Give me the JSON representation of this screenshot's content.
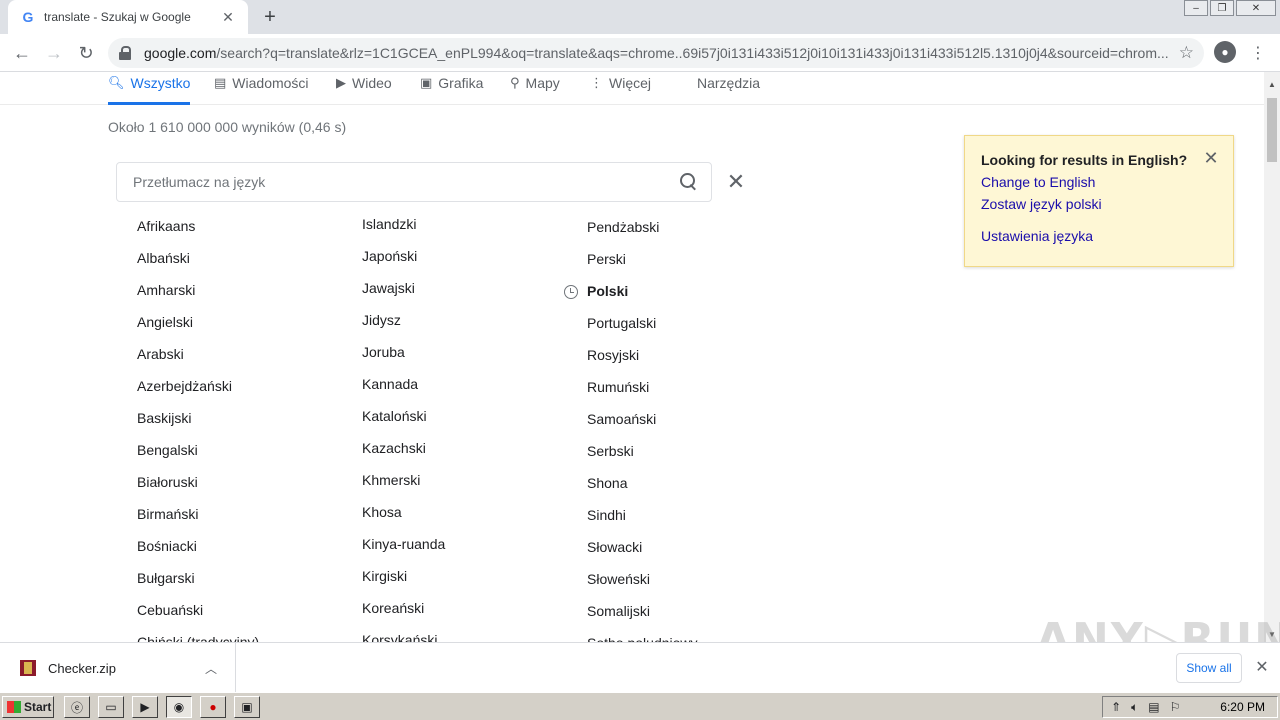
{
  "tab": {
    "title": "translate - Szukaj w Google",
    "favicon": "G"
  },
  "window_controls": [
    "–",
    "❐",
    "✕"
  ],
  "omnibox": {
    "host": "google.com",
    "path": "/search?q=translate&rlz=1C1GCEA_enPL994&oq=translate&aqs=chrome..69i57j0i131i433i512j0i10i131i433j0i131i433i512l5.1310j0j4&sourceid=chrom..."
  },
  "search_tabs": [
    {
      "label": "Wszystko",
      "icon": "search-icon"
    },
    {
      "label": "Wiadomości",
      "icon": "news-icon"
    },
    {
      "label": "Wideo",
      "icon": "video-icon"
    },
    {
      "label": "Grafika",
      "icon": "image-icon"
    },
    {
      "label": "Mapy",
      "icon": "pin-icon"
    },
    {
      "label": "Więcej",
      "icon": "more-icon"
    },
    {
      "label": "Narzędzia",
      "icon": ""
    }
  ],
  "stats": "Około 1 610 000 000 wyników (0,46 s)",
  "lang_search": {
    "placeholder": "Przetłumacz na język"
  },
  "languages": {
    "col1": [
      "Afrikaans",
      "Albański",
      "Amharski",
      "Angielski",
      "Arabski",
      "Azerbejdżański",
      "Baskijski",
      "Bengalski",
      "Białoruski",
      "Birmański",
      "Bośniacki",
      "Bułgarski",
      "Cebuański",
      "Chiński (tradycyjny)"
    ],
    "col2": [
      "Islandzki",
      "Japoński",
      "Jawajski",
      "Jidysz",
      "Joruba",
      "Kannada",
      "Kataloński",
      "Kazachski",
      "Khmerski",
      "Khosa",
      "Kinya-ruanda",
      "Kirgiski",
      "Koreański",
      "Korsykański"
    ],
    "col3": [
      "Pendżabski",
      "Perski",
      "Polski",
      "Portugalski",
      "Rosyjski",
      "Rumuński",
      "Samoański",
      "Serbski",
      "Shona",
      "Sindhi",
      "Słowacki",
      "Słoweński",
      "Somalijski",
      "Sotho południowy"
    ]
  },
  "english_card": {
    "title": "Looking for results in English?",
    "link1": "Change to English",
    "link2": "Zostaw język polski",
    "link3": "Ustawienia języka"
  },
  "download": {
    "filename": "Checker.zip",
    "show_all": "Show all"
  },
  "watermark": "ANY▷RUN",
  "taskbar": {
    "start": "Start",
    "clock": "6:20 PM"
  }
}
